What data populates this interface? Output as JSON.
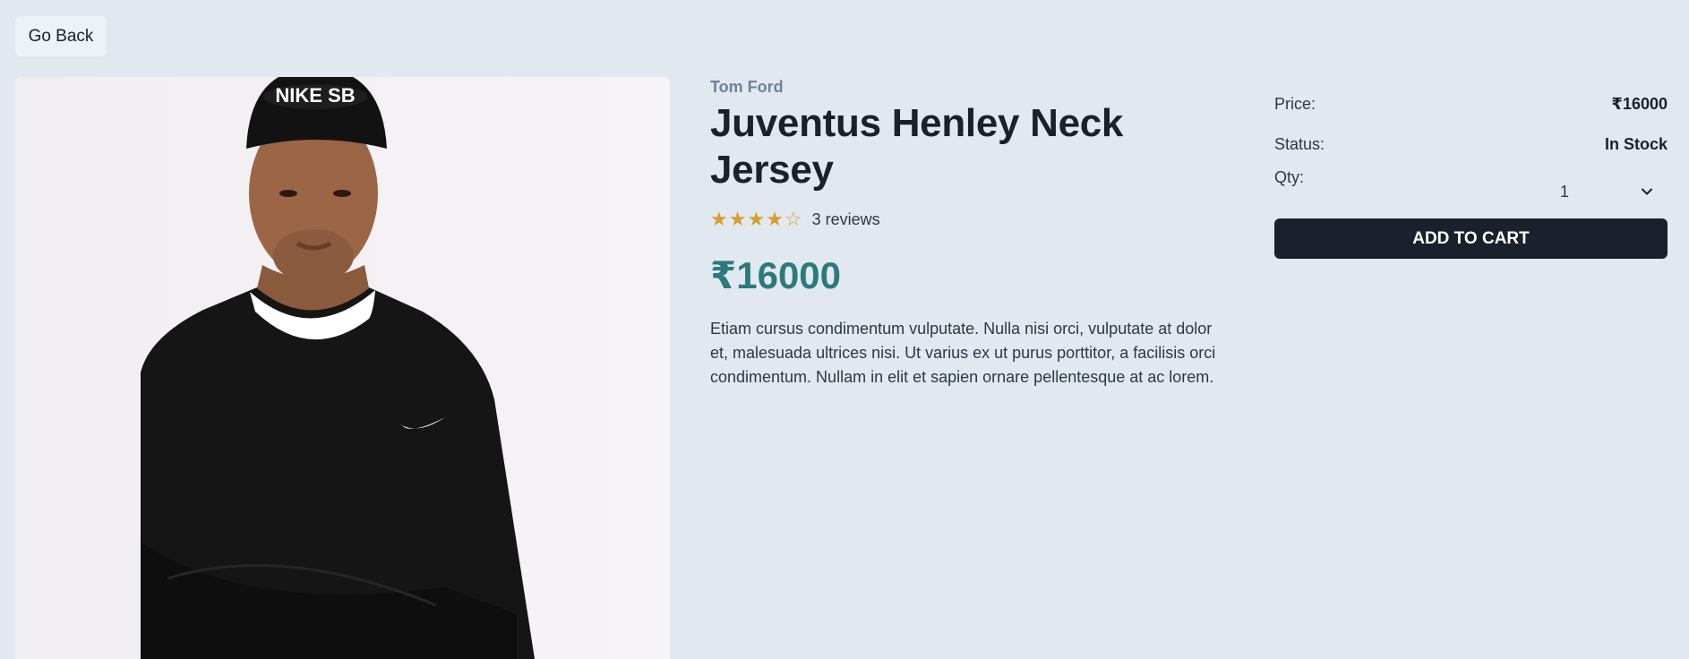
{
  "nav": {
    "back_label": "Go Back"
  },
  "product": {
    "brand": "Tom Ford",
    "name": "Juventus Henley Neck Jersey",
    "rating": 4,
    "rating_max": 5,
    "stars_filled": "★★★★",
    "stars_empty": "☆",
    "reviews_text": "3 reviews",
    "price": "₹16000",
    "description": "Etiam cursus condimentum vulputate. Nulla nisi orci, vulputate at dolor et, malesuada ultrices nisi. Ut varius ex ut purus porttitor, a facilisis orci condimentum. Nullam in elit et sapien ornare pellentesque at ac lorem.",
    "image_logo_text": "NIKE SB"
  },
  "buybox": {
    "price_label": "Price:",
    "price_value": "₹16000",
    "status_label": "Status:",
    "status_value": "In Stock",
    "qty_label": "Qty:",
    "qty_value": "1",
    "add_to_cart_label": "ADD TO CART"
  },
  "colors": {
    "background": "#e2e8f0",
    "brand_text": "#718096",
    "price_accent": "#2c7a7b",
    "star": "#d69e2e",
    "button_dark": "#1a202c"
  }
}
